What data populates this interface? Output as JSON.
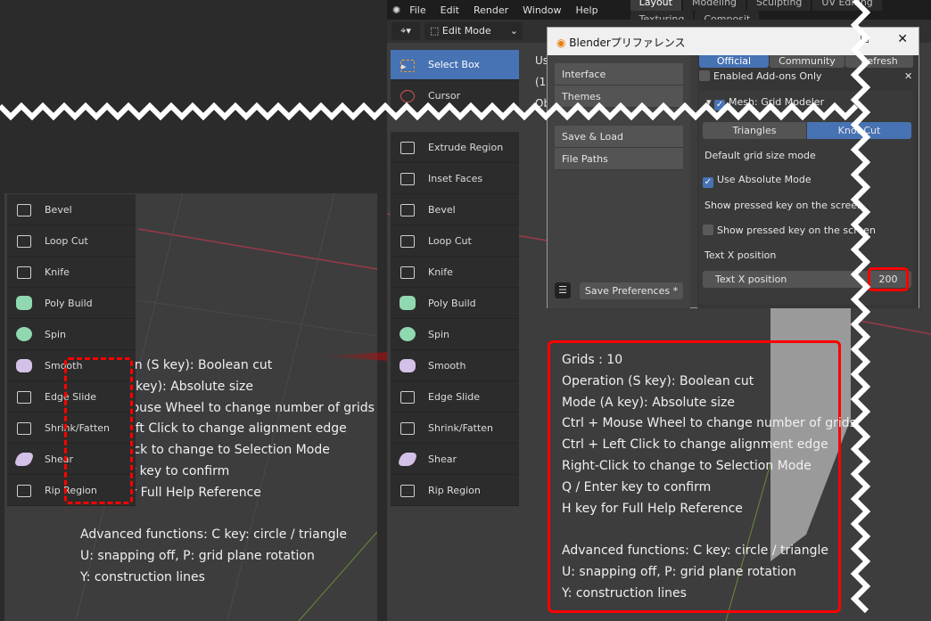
{
  "colors": {
    "accent": "#4772b3",
    "highlight": "#ff0000",
    "viewport": "#3d3d3d"
  },
  "menu": [
    "File",
    "Edit",
    "Render",
    "Window",
    "Help"
  ],
  "workspace_tabs": [
    "Layout",
    "Modeling",
    "Sculpting",
    "UV Editing",
    "Texturing",
    "Composit"
  ],
  "mode_select": "Edit Mode",
  "viewport_header": {
    "line1": "Us",
    "line2": "(1)",
    "line3": "Ob"
  },
  "tools_right_top": [
    "Select Box",
    "Cursor"
  ],
  "tools": [
    "Extrude Region",
    "Inset Faces",
    "Bevel",
    "Loop Cut",
    "Knife",
    "Poly Build",
    "Spin",
    "Smooth",
    "Edge Slide",
    "Shrink/Fatten",
    "Shear",
    "Rip Region"
  ],
  "tools_left": [
    "Bevel",
    "Loop Cut",
    "Knife",
    "Poly Build",
    "Spin",
    "Smooth",
    "Edge Slide",
    "Shrink/Fatten",
    "Shear",
    "Rip Region"
  ],
  "prefs": {
    "title": "Blenderプリファレンス",
    "nav": [
      "Interface",
      "Themes",
      "Save & Load",
      "File Paths"
    ],
    "top_buttons": [
      "Official",
      "Community",
      "Refresh"
    ],
    "enabled_only": "Enabled Add-ons Only",
    "addon": "Mesh: Grid Modeler",
    "seg": [
      "Triangles",
      "Knot Cut"
    ],
    "grid_mode_label": "Default grid size mode",
    "absolute": "Use Absolute Mode",
    "show_key_label": "Show pressed key on the screen",
    "show_key_check": "Show pressed key on the screen",
    "textx_label": "Text X position",
    "textx_field": "Text X position",
    "textx_value": "200",
    "save": "Save Preferences *"
  },
  "help_left": [
    "Grids : 10",
    "Operation (S key): Boolean cut",
    "Mode (A key): Absolute size",
    "Ctrl + Mouse Wheel to change number of grids",
    "Ctrl + Left Click to change alignment edge",
    "Right-Click to change to Selection Mode",
    "Q / Enter key to confirm",
    "H key for Full Help Reference",
    "",
    "Advanced functions: C key: circle / triangle",
    "U: snapping off, P: grid plane rotation",
    "Y: construction lines"
  ],
  "help_right": [
    "Grids : 10",
    "Operation (S key): Boolean cut",
    "Mode (A key): Absolute size",
    "Ctrl + Mouse Wheel to change number of grids",
    "Ctrl + Left Click to change alignment edge",
    "Right-Click to change to Selection Mode",
    "Q / Enter key to confirm",
    "H key for Full Help Reference",
    "",
    "Advanced functions: C key: circle / triangle",
    "U: snapping off, P: grid plane rotation",
    "Y: construction lines"
  ]
}
